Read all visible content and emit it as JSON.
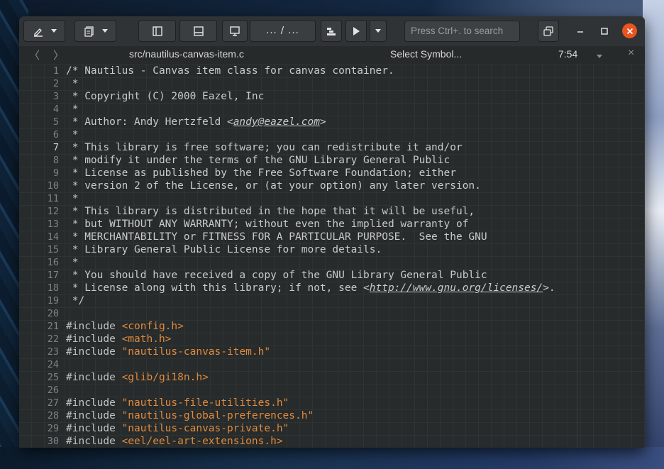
{
  "header": {
    "search_placeholder": "Press Ctrl+. to search",
    "breadcrumb_label": "... / ...",
    "icons": [
      "pencil-icon",
      "documents-icon",
      "left-panel-icon",
      "bottom-panel-icon",
      "monitor-icon",
      "build-icon",
      "play-icon",
      "chevron-down-icon",
      "window-switch-icon",
      "minimize-icon",
      "maximize-icon",
      "close-icon"
    ]
  },
  "tabbar": {
    "back": "〈",
    "forward": "〉",
    "filename": "src/nautilus-canvas-item.c",
    "symbol": "Select Symbol...",
    "position": "7:54",
    "close": "×"
  },
  "editor": {
    "current_line": 7,
    "lines": [
      {
        "n": "1",
        "segs": [
          [
            "cmt",
            "/* Nautilus - Canvas item class for canvas container."
          ]
        ]
      },
      {
        "n": "2",
        "segs": [
          [
            "cmt",
            " *"
          ]
        ]
      },
      {
        "n": "3",
        "segs": [
          [
            "cmt",
            " * Copyright (C) 2000 Eazel, Inc"
          ]
        ]
      },
      {
        "n": "4",
        "segs": [
          [
            "cmt",
            " *"
          ]
        ]
      },
      {
        "n": "5",
        "segs": [
          [
            "cmt",
            " * Author: Andy Hertzfeld <"
          ],
          [
            "lnk",
            "andy@eazel.com"
          ],
          [
            "cmt",
            ">"
          ]
        ]
      },
      {
        "n": "6",
        "segs": [
          [
            "cmt",
            " *"
          ]
        ]
      },
      {
        "n": "7",
        "segs": [
          [
            "cmt",
            " * This library is free software; you can redistribute it and/or"
          ]
        ]
      },
      {
        "n": "8",
        "segs": [
          [
            "cmt",
            " * modify it under the terms of the GNU Library General Public"
          ]
        ]
      },
      {
        "n": "9",
        "segs": [
          [
            "cmt",
            " * License as published by the Free Software Foundation; either"
          ]
        ]
      },
      {
        "n": "10",
        "segs": [
          [
            "cmt",
            " * version 2 of the License, or (at your option) any later version."
          ]
        ]
      },
      {
        "n": "11",
        "segs": [
          [
            "cmt",
            " *"
          ]
        ]
      },
      {
        "n": "12",
        "segs": [
          [
            "cmt",
            " * This library is distributed in the hope that it will be useful,"
          ]
        ]
      },
      {
        "n": "13",
        "segs": [
          [
            "cmt",
            " * but WITHOUT ANY WARRANTY; without even the implied warranty of"
          ]
        ]
      },
      {
        "n": "14",
        "segs": [
          [
            "cmt",
            " * MERCHANTABILITY or FITNESS FOR A PARTICULAR PURPOSE.  See the GNU"
          ]
        ]
      },
      {
        "n": "15",
        "segs": [
          [
            "cmt",
            " * Library General Public License for more details."
          ]
        ]
      },
      {
        "n": "16",
        "segs": [
          [
            "cmt",
            " *"
          ]
        ]
      },
      {
        "n": "17",
        "segs": [
          [
            "cmt",
            " * You should have received a copy of the GNU Library General Public"
          ]
        ]
      },
      {
        "n": "18",
        "segs": [
          [
            "cmt",
            " * License along with this library; if not, see <"
          ],
          [
            "lnk",
            "http://www.gnu.org/licenses/"
          ],
          [
            "cmt",
            ">."
          ]
        ]
      },
      {
        "n": "19",
        "segs": [
          [
            "cmt",
            " */"
          ]
        ]
      },
      {
        "n": "20",
        "segs": []
      },
      {
        "n": "21",
        "segs": [
          [
            "pp",
            "#include "
          ],
          [
            "str",
            "<config.h>"
          ]
        ]
      },
      {
        "n": "22",
        "segs": [
          [
            "pp",
            "#include "
          ],
          [
            "str",
            "<math.h>"
          ]
        ]
      },
      {
        "n": "23",
        "segs": [
          [
            "pp",
            "#include "
          ],
          [
            "str",
            "\"nautilus-canvas-item.h\""
          ]
        ]
      },
      {
        "n": "24",
        "segs": []
      },
      {
        "n": "25",
        "segs": [
          [
            "pp",
            "#include "
          ],
          [
            "str",
            "<glib/gi18n.h>"
          ]
        ]
      },
      {
        "n": "26",
        "segs": []
      },
      {
        "n": "27",
        "segs": [
          [
            "pp",
            "#include "
          ],
          [
            "str",
            "\"nautilus-file-utilities.h\""
          ]
        ]
      },
      {
        "n": "28",
        "segs": [
          [
            "pp",
            "#include "
          ],
          [
            "str",
            "\"nautilus-global-preferences.h\""
          ]
        ]
      },
      {
        "n": "29",
        "segs": [
          [
            "pp",
            "#include "
          ],
          [
            "str",
            "\"nautilus-canvas-private.h\""
          ]
        ]
      },
      {
        "n": "30",
        "segs": [
          [
            "pp",
            "#include "
          ],
          [
            "str",
            "<eel/eel-art-extensions.h>"
          ]
        ]
      }
    ]
  },
  "colors": {
    "accent_close": "#e95420",
    "string": "#e08a3c",
    "editor_bg": "#272b2c"
  }
}
